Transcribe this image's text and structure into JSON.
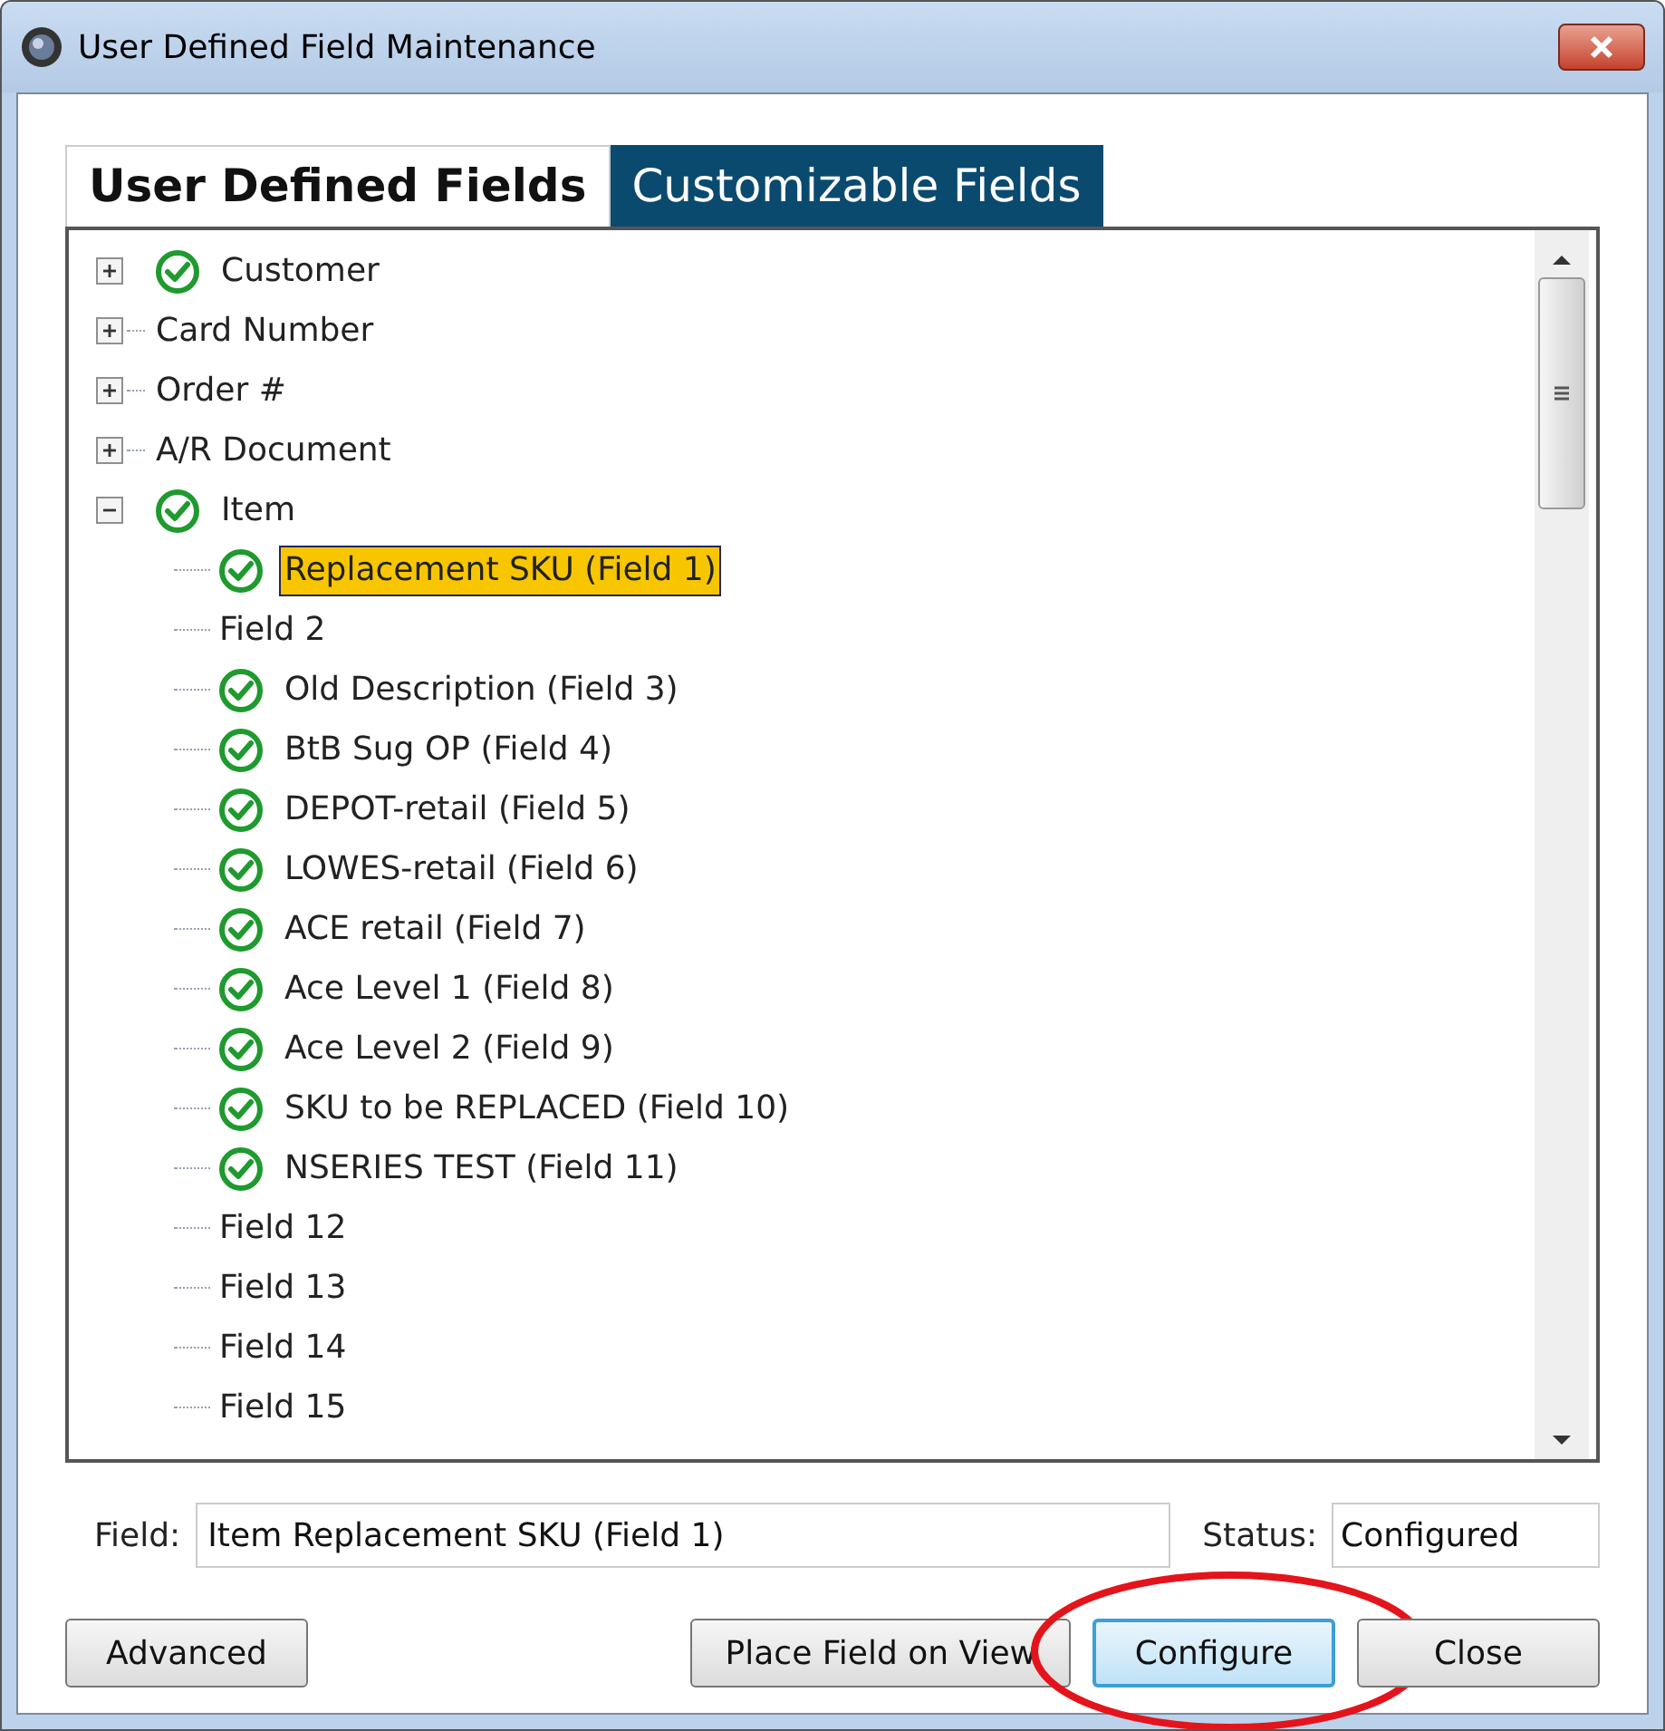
{
  "window": {
    "title": "User Defined Field Maintenance"
  },
  "tabs": [
    {
      "label": "User Defined Fields",
      "selected": true
    },
    {
      "label": "Customizable Fields",
      "selected": false
    }
  ],
  "tree": [
    {
      "label": "Customer",
      "checked": true,
      "expanded": false
    },
    {
      "label": "Card Number",
      "checked": false,
      "expanded": false
    },
    {
      "label": "Order #",
      "checked": false,
      "expanded": false
    },
    {
      "label": "A/R Document",
      "checked": false,
      "expanded": false
    },
    {
      "label": "Item",
      "checked": true,
      "expanded": true,
      "children": [
        {
          "label": "Replacement SKU (Field 1)",
          "checked": true,
          "selected": true
        },
        {
          "label": "Field 2",
          "checked": false,
          "selected": false
        },
        {
          "label": "Old Description (Field 3)",
          "checked": true,
          "selected": false
        },
        {
          "label": "BtB Sug OP (Field 4)",
          "checked": true,
          "selected": false
        },
        {
          "label": "DEPOT-retail (Field 5)",
          "checked": true,
          "selected": false
        },
        {
          "label": "LOWES-retail (Field 6)",
          "checked": true,
          "selected": false
        },
        {
          "label": "ACE retail (Field 7)",
          "checked": true,
          "selected": false
        },
        {
          "label": "Ace Level 1 (Field 8)",
          "checked": true,
          "selected": false
        },
        {
          "label": "Ace Level 2 (Field 9)",
          "checked": true,
          "selected": false
        },
        {
          "label": "SKU to be REPLACED (Field 10)",
          "checked": true,
          "selected": false
        },
        {
          "label": "NSERIES TEST (Field 11)",
          "checked": true,
          "selected": false
        },
        {
          "label": "Field 12",
          "checked": false,
          "selected": false
        },
        {
          "label": "Field 13",
          "checked": false,
          "selected": false
        },
        {
          "label": "Field 14",
          "checked": false,
          "selected": false
        },
        {
          "label": "Field 15",
          "checked": false,
          "selected": false
        }
      ]
    }
  ],
  "field": {
    "label": "Field:",
    "value": "Item Replacement SKU (Field 1)"
  },
  "status": {
    "label": "Status:",
    "value": "Configured"
  },
  "buttons": [
    {
      "label": "Advanced",
      "focused": false,
      "highlighted": false
    },
    {
      "label": "Place Field on View",
      "focused": false,
      "highlighted": false
    },
    {
      "label": "Configure",
      "focused": true,
      "highlighted": true
    },
    {
      "label": "Close",
      "focused": false,
      "highlighted": false
    }
  ]
}
